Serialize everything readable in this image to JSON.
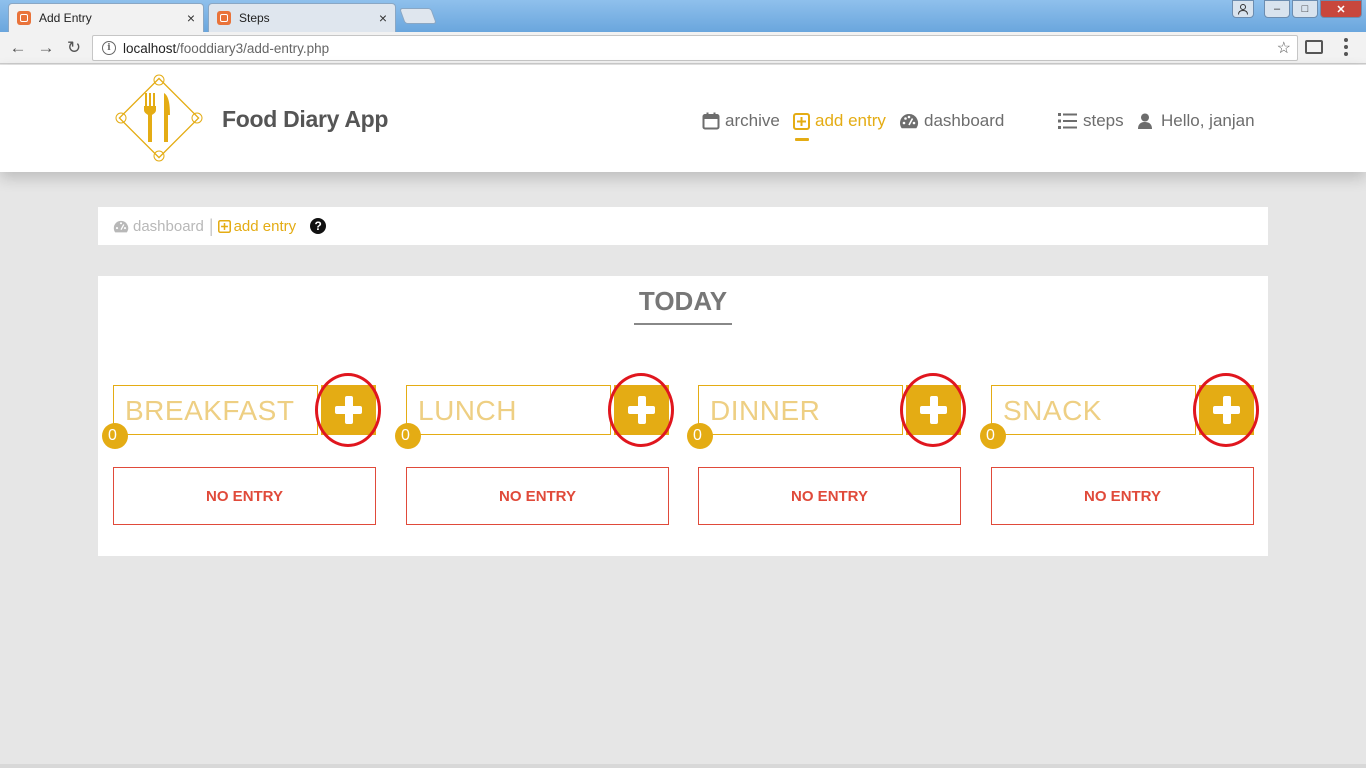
{
  "browser": {
    "tabs": [
      {
        "title": "Add Entry",
        "close": "×"
      },
      {
        "title": "Steps",
        "close": "×"
      }
    ],
    "window_buttons": {
      "minimize": "–",
      "maximize": "□",
      "close": "✕"
    },
    "nav": {
      "back": "←",
      "forward": "→",
      "reload": "↻"
    },
    "address": {
      "host": "localhost",
      "path": "/fooddiary3/add-entry.php"
    },
    "bookmark": "☆"
  },
  "header": {
    "app_name": "Food Diary App",
    "nav": [
      {
        "label": "archive",
        "icon": "calendar-icon"
      },
      {
        "label": "add entry",
        "icon": "plus-square-icon",
        "active": true
      },
      {
        "label": "dashboard",
        "icon": "dashboard-icon"
      },
      {
        "label": "steps",
        "icon": "list-icon"
      },
      {
        "label": "Hello, janjan",
        "icon": "user-icon"
      }
    ]
  },
  "breadcrumb": {
    "dashboard": "dashboard",
    "separator": "|",
    "current": "add entry",
    "help": "?"
  },
  "main": {
    "heading": "TODAY",
    "meals": [
      {
        "name": "BREAKFAST",
        "count": "0",
        "status": "NO ENTRY"
      },
      {
        "name": "LUNCH",
        "count": "0",
        "status": "NO ENTRY"
      },
      {
        "name": "DINNER",
        "count": "0",
        "status": "NO ENTRY"
      },
      {
        "name": "SNACK",
        "count": "0",
        "status": "NO ENTRY"
      }
    ]
  },
  "colors": {
    "accent": "#e4ac14",
    "no_entry": "#e04a3a",
    "annotation_ring": "#e0161e",
    "background": "#e6e6e6"
  }
}
